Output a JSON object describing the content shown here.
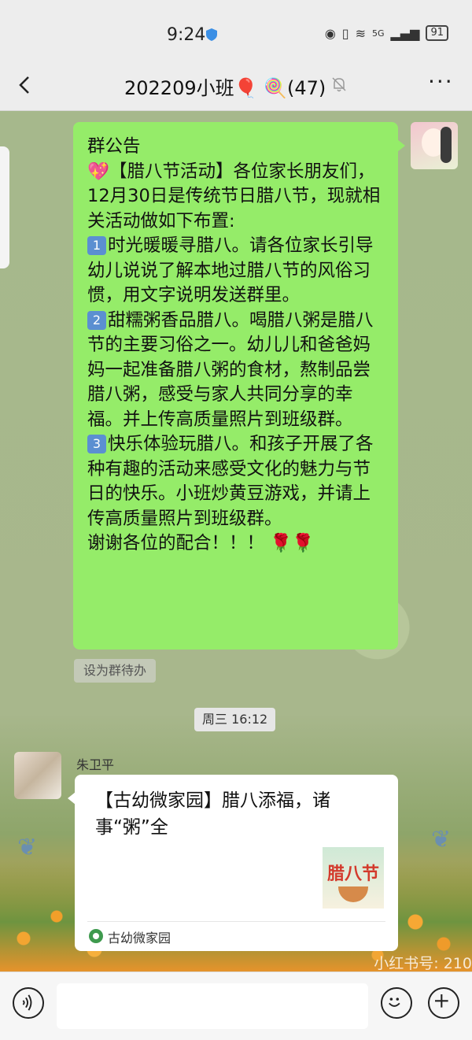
{
  "status_bar": {
    "time": "9:24",
    "network": "5G",
    "battery": "91"
  },
  "header": {
    "title": "202209小班🎈 🍭(47)"
  },
  "messages": {
    "announcement": {
      "label": "群公告",
      "lines": [
        "💖【腊八节活动】各位家长朋友们，12月30日是传统节日腊八节，现就相关活动做如下布置:",
        "时光暖暖寻腊八。请各位家长引导幼儿说说了解本地过腊八节的风俗习惯，用文字说明发送群里。",
        "甜糯粥香品腊八。喝腊八粥是腊八节的主要习俗之一。幼儿儿和爸爸妈妈一起准备腊八粥的食材，熬制品尝腊八粥，感受与家人共同分享的幸福。并上传高质量照片到班级群。",
        "快乐体验玩腊八。和孩子开展了各种有趣的活动来感受文化的魅力与节日的快乐。小班炒黄豆游戏，并请上传高质量照片到班级群。",
        "谢谢各位的配合！！！ 🌹🌹"
      ],
      "item_numbers": [
        "1",
        "2",
        "3"
      ],
      "todo_label": "设为群待办"
    },
    "timestamp": "周三 16:12",
    "shared_card": {
      "sender": "朱卫平",
      "title": "【古幼微家园】腊八添福，诸事“粥”全",
      "thumb_text": "腊八节",
      "source": "古幼微家园"
    }
  },
  "watermark": "小红书号: 210",
  "colors": {
    "my_bubble": "#95ec69",
    "chat_bg": "#a9b98c",
    "header_bg": "#ededed"
  }
}
